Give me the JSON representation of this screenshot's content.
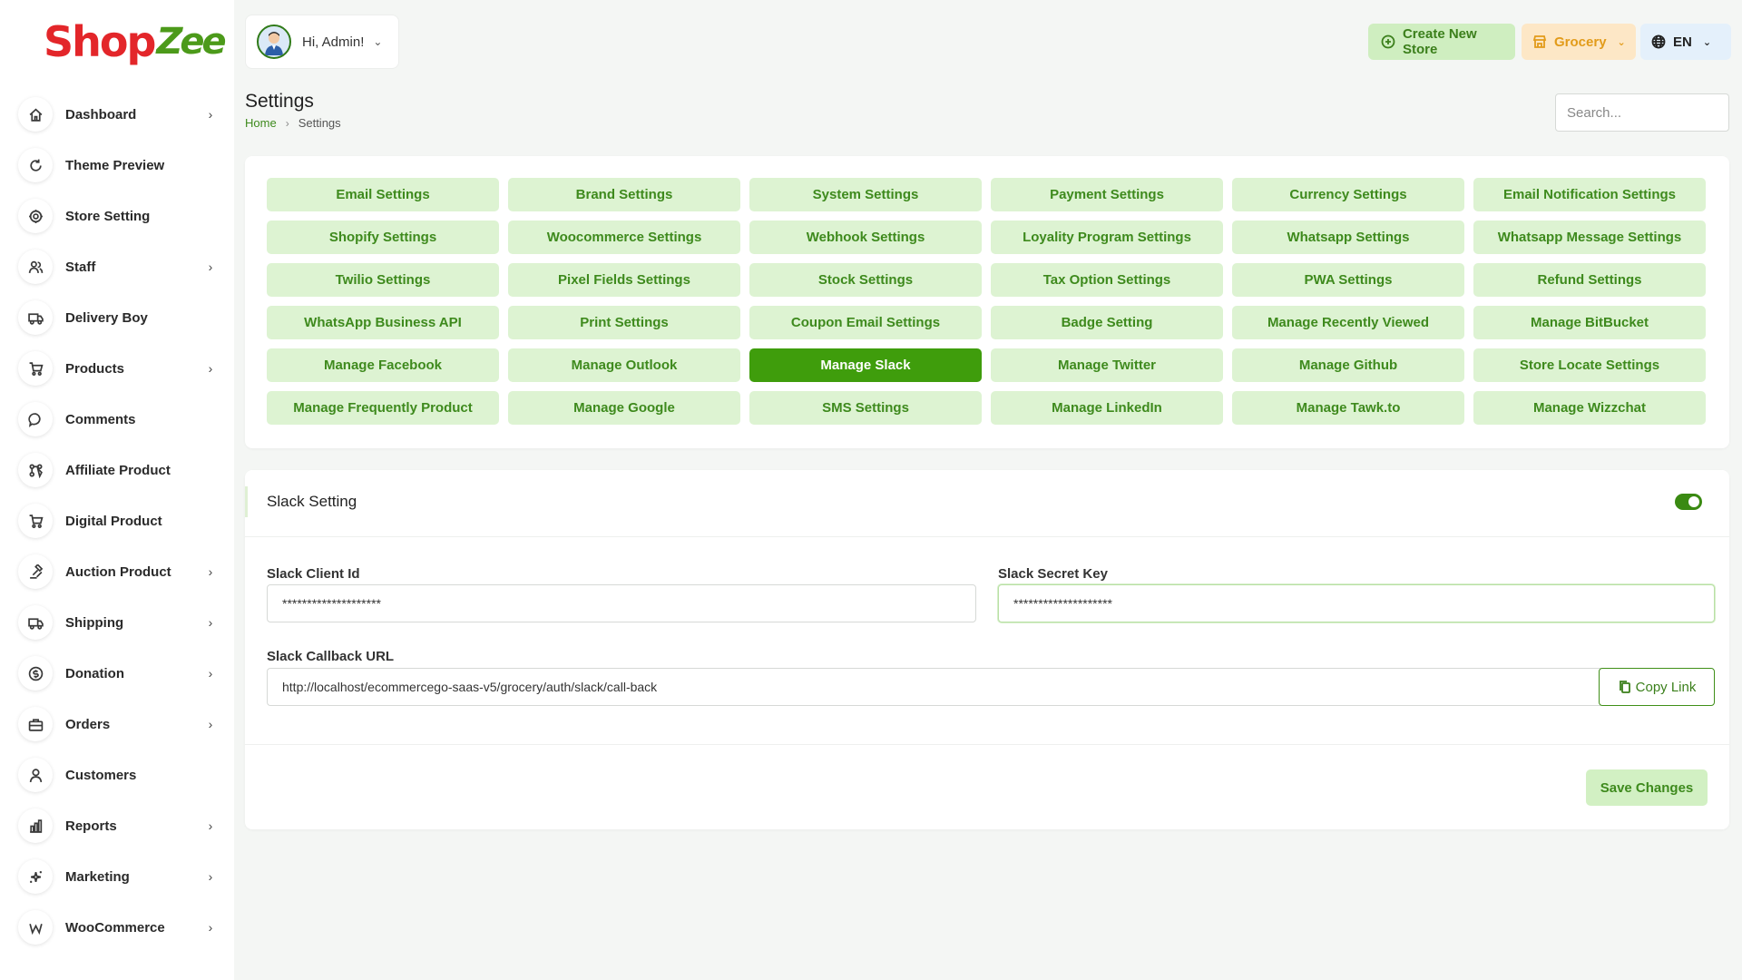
{
  "brand": {
    "logo_primary": "Shop",
    "logo_accent": "Zee"
  },
  "sidebar": {
    "items": [
      {
        "label": "Dashboard",
        "icon": "home-icon",
        "has_children": true
      },
      {
        "label": "Theme Preview",
        "icon": "refresh-icon",
        "has_children": false
      },
      {
        "label": "Store Setting",
        "icon": "gear-icon",
        "has_children": false
      },
      {
        "label": "Staff",
        "icon": "users-icon",
        "has_children": true
      },
      {
        "label": "Delivery Boy",
        "icon": "truck-icon",
        "has_children": false
      },
      {
        "label": "Products",
        "icon": "cart-icon",
        "has_children": true
      },
      {
        "label": "Comments",
        "icon": "chat-icon",
        "has_children": false
      },
      {
        "label": "Affiliate Product",
        "icon": "affiliate-icon",
        "has_children": false
      },
      {
        "label": "Digital Product",
        "icon": "cart-icon",
        "has_children": false
      },
      {
        "label": "Auction Product",
        "icon": "auction-icon",
        "has_children": true
      },
      {
        "label": "Shipping",
        "icon": "truck-icon",
        "has_children": true
      },
      {
        "label": "Donation",
        "icon": "coin-icon",
        "has_children": true
      },
      {
        "label": "Orders",
        "icon": "briefcase-icon",
        "has_children": true
      },
      {
        "label": "Customers",
        "icon": "user-icon",
        "has_children": false
      },
      {
        "label": "Reports",
        "icon": "chart-icon",
        "has_children": true
      },
      {
        "label": "Marketing",
        "icon": "sparkle-icon",
        "has_children": true
      },
      {
        "label": "WooCommerce",
        "icon": "woo-icon",
        "has_children": true
      }
    ]
  },
  "header": {
    "greeting": "Hi, Admin!",
    "create_store_label": "Create New Store",
    "store_label": "Grocery",
    "language_label": "EN"
  },
  "page": {
    "title": "Settings",
    "breadcrumb_home": "Home",
    "breadcrumb_current": "Settings",
    "search_placeholder": "Search..."
  },
  "settings_tabs": [
    "Email Settings",
    "Brand Settings",
    "System Settings",
    "Payment Settings",
    "Currency Settings",
    "Email Notification Settings",
    "Shopify Settings",
    "Woocommerce Settings",
    "Webhook Settings",
    "Loyality Program Settings",
    "Whatsapp Settings",
    "Whatsapp Message Settings",
    "Twilio Settings",
    "Pixel Fields Settings",
    "Stock Settings",
    "Tax Option Settings",
    "PWA Settings",
    "Refund Settings",
    "WhatsApp Business API",
    "Print Settings",
    "Coupon Email Settings",
    "Badge Setting",
    "Manage Recently Viewed",
    "Manage BitBucket",
    "Manage Facebook",
    "Manage Outlook",
    "Manage Slack",
    "Manage Twitter",
    "Manage Github",
    "Store Locate Settings",
    "Manage Frequently Product",
    "Manage Google",
    "SMS Settings",
    "Manage LinkedIn",
    "Manage Tawk.to",
    "Manage Wizzchat"
  ],
  "active_tab": "Manage Slack",
  "slack": {
    "title": "Slack Setting",
    "enabled": true,
    "client_id_label": "Slack Client Id",
    "client_id_value": "********************",
    "secret_key_label": "Slack Secret Key",
    "secret_key_value": "********************",
    "callback_label": "Slack Callback URL",
    "callback_value": "http://localhost/ecommercego-saas-v5/grocery/auth/slack/call-back",
    "copy_label": "Copy Link",
    "save_label": "Save Changes"
  },
  "colors": {
    "accent": "#3f9d0c",
    "tab_bg": "#ddf3d2",
    "brand_red": "#e3262a",
    "brand_green": "#4c9a1a"
  }
}
